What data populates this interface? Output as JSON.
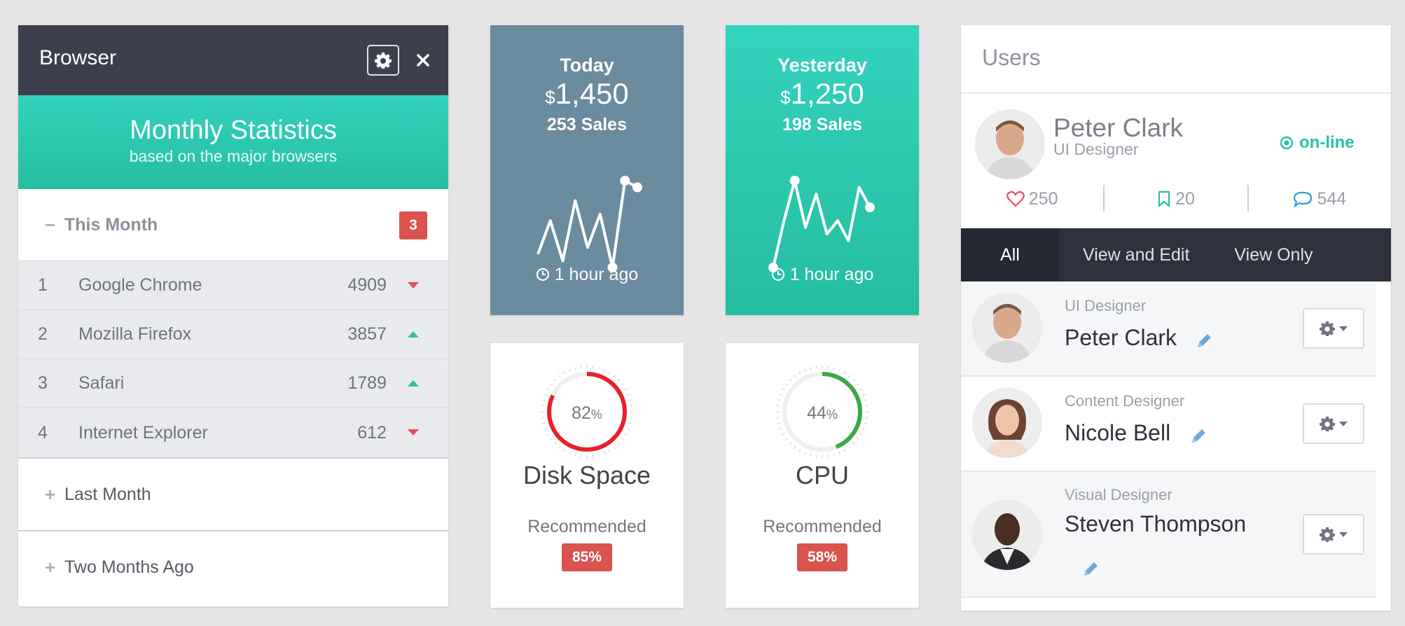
{
  "browser": {
    "title": "Browser",
    "banner_title": "Monthly Statistics",
    "banner_subtitle": "based on the major browsers",
    "this_month": {
      "symbol": "−",
      "label": "This Month",
      "badge": "3"
    },
    "rows": [
      {
        "rank": "1",
        "name": "Google Chrome",
        "value": "4909",
        "trend": "down"
      },
      {
        "rank": "2",
        "name": "Mozilla Firefox",
        "value": "3857",
        "trend": "up"
      },
      {
        "rank": "3",
        "name": "Safari",
        "value": "1789",
        "trend": "up"
      },
      {
        "rank": "4",
        "name": "Internet Explorer",
        "value": "612",
        "trend": "down"
      }
    ],
    "last_month": {
      "symbol": "+",
      "label": "Last Month"
    },
    "two_months": {
      "symbol": "+",
      "label": "Two Months Ago"
    }
  },
  "tiles": {
    "today": {
      "day": "Today",
      "currency": "$",
      "amount": "1,450",
      "sales": "253 Sales",
      "ago": "1 hour ago",
      "color": "#6b8b9e",
      "spark": [
        2,
        7,
        1,
        10,
        3,
        8,
        0,
        13,
        12
      ]
    },
    "yesterday": {
      "day": "Yesterday",
      "currency": "$",
      "amount": "1,250",
      "sales": "198 Sales",
      "ago": "1 hour ago",
      "color": "#2cc9ae",
      "spark": [
        0,
        7,
        13,
        6,
        11,
        5,
        7,
        4,
        12,
        9
      ]
    }
  },
  "gauges": {
    "disk": {
      "value": "82",
      "unit": "%",
      "fraction": 0.82,
      "name": "Disk Space",
      "recommended": "Recommended",
      "badge": "85%",
      "color": "#e8202a"
    },
    "cpu": {
      "value": "44",
      "unit": "%",
      "fraction": 0.44,
      "name": "CPU",
      "recommended": "Recommended",
      "badge": "58%",
      "color": "#3aa845"
    }
  },
  "users": {
    "title": "Users",
    "profile": {
      "name": "Peter Clark",
      "role": "UI Designer",
      "status": "on-line",
      "likes": "250",
      "bookmarks": "20",
      "comments": "544"
    },
    "tabs": [
      "All",
      "View and Edit",
      "View Only"
    ],
    "list": [
      {
        "role": "UI Designer",
        "name": "Peter Clark"
      },
      {
        "role": "Content Designer",
        "name": "Nicole Bell"
      },
      {
        "role": "Visual Designer",
        "name": "Steven Thompson"
      }
    ]
  },
  "colors": {
    "accent": "#27c2a5",
    "dark": "#3c404e",
    "danger": "#d9534f"
  }
}
